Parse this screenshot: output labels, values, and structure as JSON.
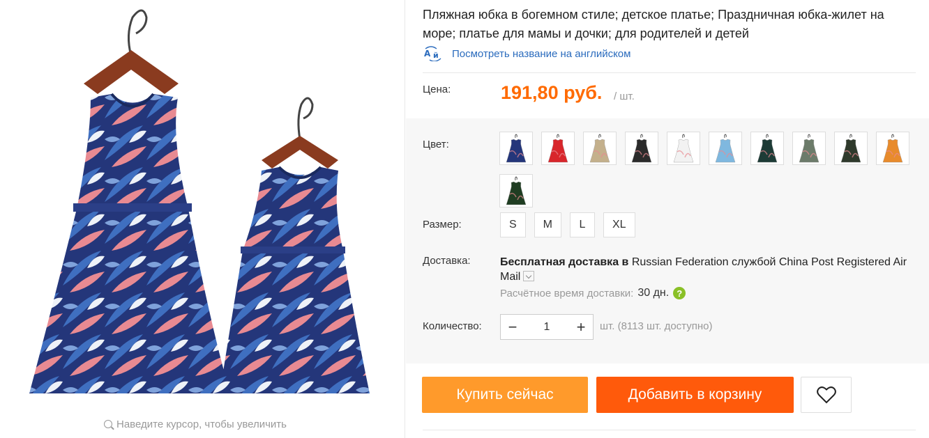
{
  "product": {
    "title": "Пляжная юбка в богемном стиле; детское платье; Праздничная юбка-жилет на море; платье для мамы и дочки; для родителей и детей",
    "translate_link": "Посмотреть название на английском",
    "translate_icon": "translate-icon"
  },
  "gallery": {
    "zoom_hint": "Наведите курсор, чтобы увеличить",
    "zoom_icon": "magnifier-icon"
  },
  "price": {
    "label": "Цена:",
    "value": "191,80 руб.",
    "unit": "/ шт.",
    "color": "#ff6a00"
  },
  "color": {
    "label": "Цвет:",
    "swatches": [
      {
        "color": "#24367a"
      },
      {
        "color": "#d8262b"
      },
      {
        "color": "#c4b08c"
      },
      {
        "color": "#2b2b2b"
      },
      {
        "color": "#f2f2f2"
      },
      {
        "color": "#7fb8df"
      },
      {
        "color": "#1d3b36"
      },
      {
        "color": "#6c7b6a"
      },
      {
        "color": "#2f3a2c"
      },
      {
        "color": "#e88b2c"
      },
      {
        "color": "#1f3d22"
      }
    ]
  },
  "size": {
    "label": "Размер:",
    "options": [
      "S",
      "M",
      "L",
      "XL"
    ]
  },
  "shipping": {
    "label": "Доставка:",
    "free_text": "Бесплатная доставка в",
    "rest_text": " Russian Federation службой China Post Registered Air Mail",
    "eta_label": "Расчётное время доставки:",
    "eta_value": "30 дн.",
    "help": "?"
  },
  "quantity": {
    "label": "Количество:",
    "minus": "−",
    "value": "1",
    "plus": "+",
    "available": "шт. (8113 шт. доступно)"
  },
  "actions": {
    "buy_now": "Купить сейчас",
    "add_to_cart": "Добавить в корзину",
    "wishlist_icon": "heart-icon"
  }
}
